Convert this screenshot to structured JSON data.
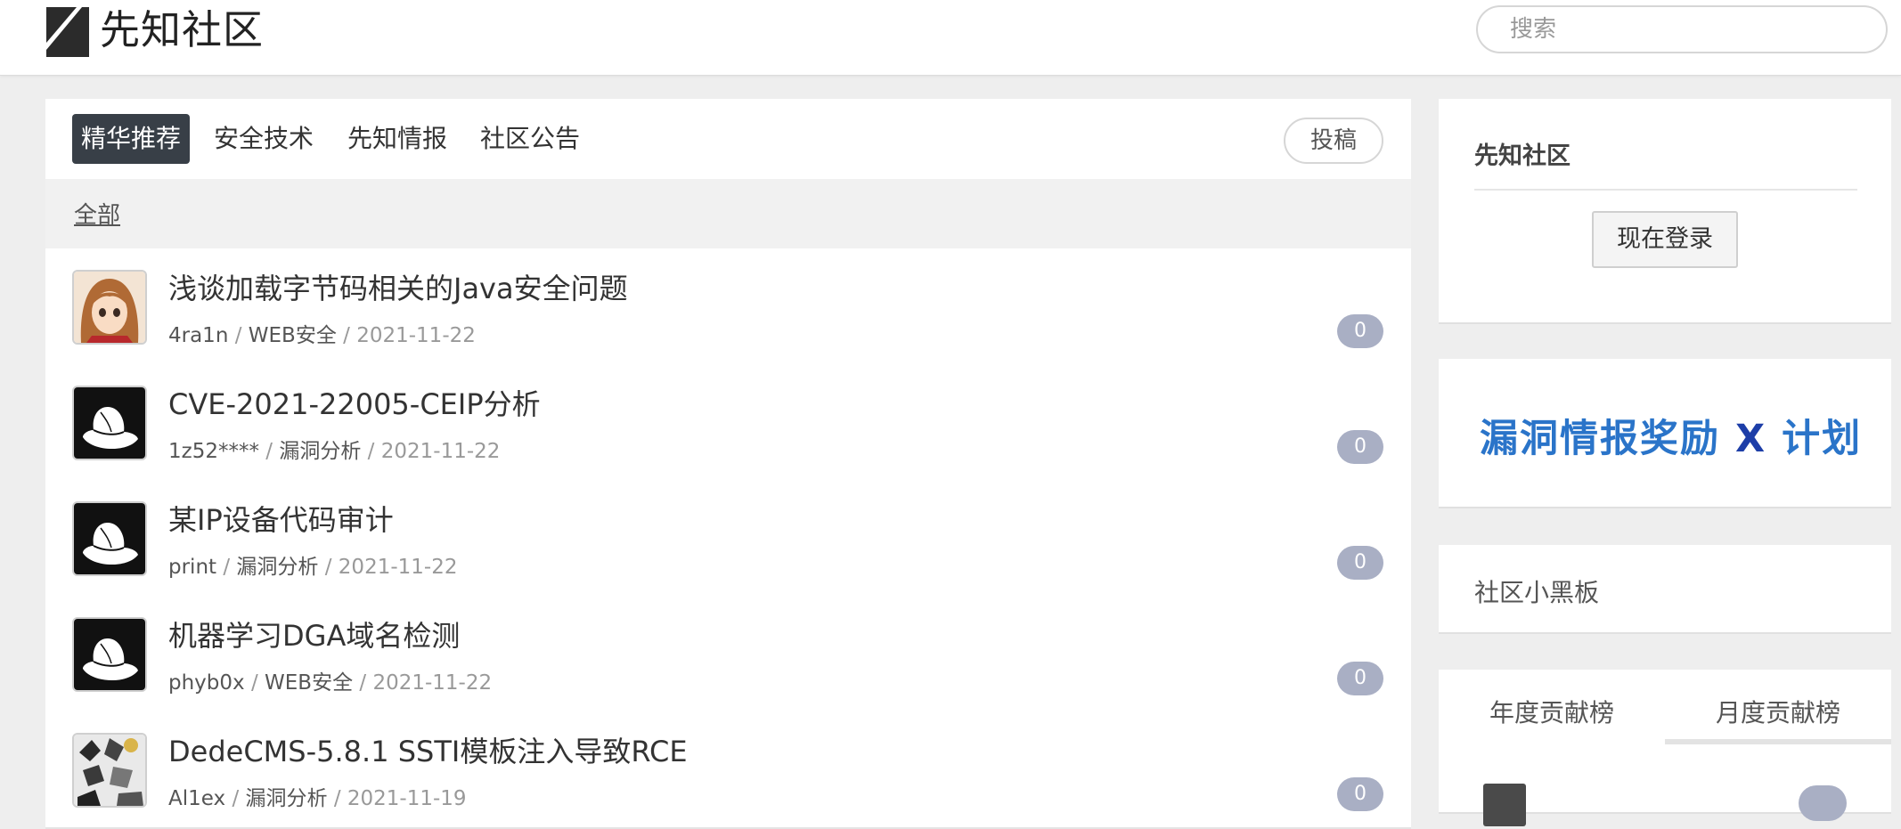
{
  "header": {
    "logo_text": "先知社区",
    "search_placeholder": "搜索"
  },
  "tabs": [
    {
      "label": "精华推荐",
      "active": true
    },
    {
      "label": "安全技术",
      "active": false
    },
    {
      "label": "先知情报",
      "active": false
    },
    {
      "label": "社区公告",
      "active": false
    }
  ],
  "submit_label": "投稿",
  "filter": {
    "all_label": "全部"
  },
  "posts": [
    {
      "title": "浅谈加载字节码相关的Java安全问题",
      "author": "4ra1n",
      "category": "WEB安全",
      "date": "2021-11-22",
      "comments": "0",
      "avatar": "anime-girl-avatar"
    },
    {
      "title": "CVE-2021-22005-CEIP分析",
      "author": "1z52****",
      "category": "漏洞分析",
      "date": "2021-11-22",
      "comments": "0",
      "avatar": "hat-avatar"
    },
    {
      "title": "某IP设备代码审计",
      "author": "print",
      "category": "漏洞分析",
      "date": "2021-11-22",
      "comments": "0",
      "avatar": "hat-avatar"
    },
    {
      "title": "机器学习DGA域名检测",
      "author": "phyb0x",
      "category": "WEB安全",
      "date": "2021-11-22",
      "comments": "0",
      "avatar": "hat-avatar"
    },
    {
      "title": "DedeCMS-5.8.1 SSTI模板注入导致RCE",
      "author": "Al1ex",
      "category": "漏洞分析",
      "date": "2021-11-19",
      "comments": "0",
      "avatar": "collage-avatar"
    }
  ],
  "sidebar": {
    "community_title": "先知社区",
    "login_label": "现在登录",
    "banner": {
      "part1": "漏洞情报奖励",
      "part2": "X",
      "part3": "计划"
    },
    "board_title": "社区小黑板",
    "rank_tabs": [
      "年度贡献榜",
      "月度贡献榜"
    ]
  },
  "colors": {
    "active_tab_bg": "#383f47",
    "badge_bg": "#a9afc4",
    "banner_blue": "#2a74c9"
  }
}
